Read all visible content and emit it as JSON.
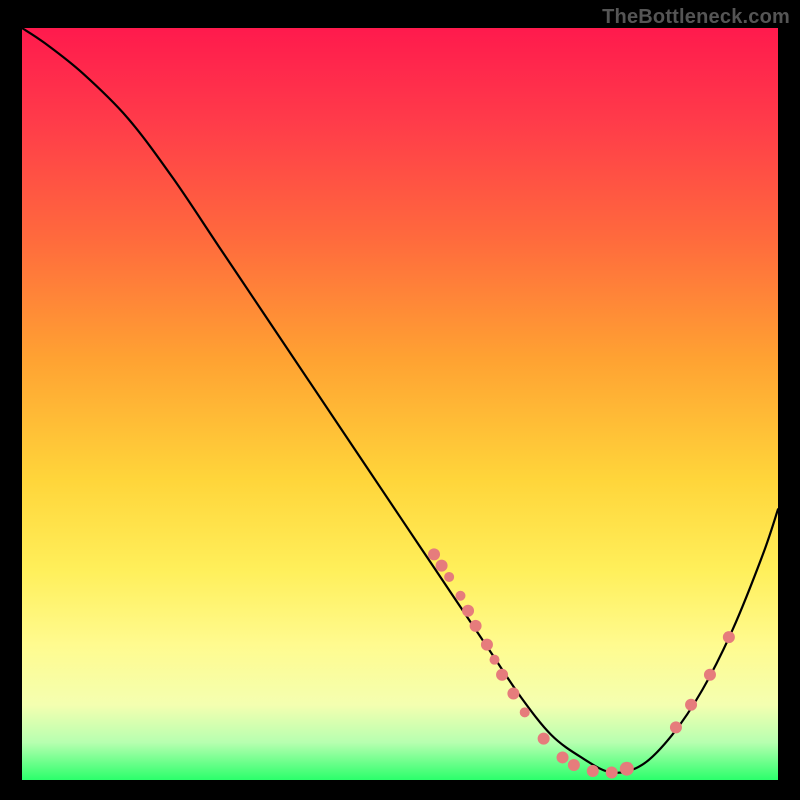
{
  "attribution": "TheBottleneck.com",
  "colors": {
    "page_bg": "#000000",
    "gradient_top": "#ff1a4d",
    "gradient_bottom": "#2bff6b",
    "curve": "#000000",
    "point_fill": "#e67c7c"
  },
  "chart_data": {
    "type": "line",
    "title": "",
    "xlabel": "",
    "ylabel": "",
    "xlim": [
      0,
      100
    ],
    "ylim": [
      0,
      100
    ],
    "grid": false,
    "legend": false,
    "series": [
      {
        "name": "bottleneck-curve",
        "x": [
          0,
          3,
          8,
          14,
          20,
          26,
          32,
          38,
          44,
          50,
          54,
          58,
          62,
          66,
          70,
          74,
          78,
          82,
          86,
          90,
          94,
          98,
          100
        ],
        "y": [
          100,
          98,
          94,
          88,
          80,
          71,
          62,
          53,
          44,
          35,
          29,
          23,
          17,
          11,
          6,
          3,
          1,
          2,
          6,
          12,
          20,
          30,
          36
        ]
      }
    ],
    "points": [
      {
        "x": 54.5,
        "y": 30.0,
        "r": 6
      },
      {
        "x": 55.5,
        "y": 28.5,
        "r": 6
      },
      {
        "x": 56.5,
        "y": 27.0,
        "r": 5
      },
      {
        "x": 58.0,
        "y": 24.5,
        "r": 5
      },
      {
        "x": 59.0,
        "y": 22.5,
        "r": 6
      },
      {
        "x": 60.0,
        "y": 20.5,
        "r": 6
      },
      {
        "x": 61.5,
        "y": 18.0,
        "r": 6
      },
      {
        "x": 62.5,
        "y": 16.0,
        "r": 5
      },
      {
        "x": 63.5,
        "y": 14.0,
        "r": 6
      },
      {
        "x": 65.0,
        "y": 11.5,
        "r": 6
      },
      {
        "x": 66.5,
        "y": 9.0,
        "r": 5
      },
      {
        "x": 69.0,
        "y": 5.5,
        "r": 6
      },
      {
        "x": 71.5,
        "y": 3.0,
        "r": 6
      },
      {
        "x": 73.0,
        "y": 2.0,
        "r": 6
      },
      {
        "x": 75.5,
        "y": 1.2,
        "r": 6
      },
      {
        "x": 78.0,
        "y": 1.0,
        "r": 6
      },
      {
        "x": 80.0,
        "y": 1.5,
        "r": 7
      },
      {
        "x": 86.5,
        "y": 7.0,
        "r": 6
      },
      {
        "x": 88.5,
        "y": 10.0,
        "r": 6
      },
      {
        "x": 91.0,
        "y": 14.0,
        "r": 6
      },
      {
        "x": 93.5,
        "y": 19.0,
        "r": 6
      }
    ]
  }
}
